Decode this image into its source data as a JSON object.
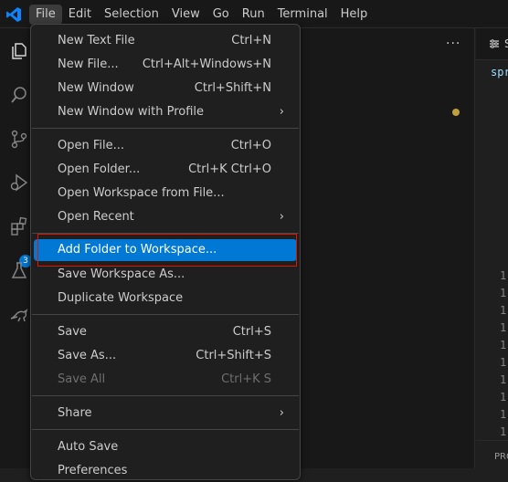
{
  "menubar": {
    "items": [
      "File",
      "Edit",
      "Selection",
      "View",
      "Go",
      "Run",
      "Terminal",
      "Help"
    ]
  },
  "activity": {
    "extensions_badge": "3"
  },
  "sidebar": {
    "more_actions": "···"
  },
  "editor": {
    "tab_label": "S",
    "code_text": "spr",
    "line_numbers": [
      "1",
      "1",
      "1",
      "1",
      "1",
      "1",
      "1",
      "1",
      "1",
      "1"
    ],
    "panel_tab": "PRO"
  },
  "file_menu": {
    "items": [
      {
        "label": "New Text File",
        "shortcut": "Ctrl+N"
      },
      {
        "label": "New File...",
        "shortcut": "Ctrl+Alt+Windows+N"
      },
      {
        "label": "New Window",
        "shortcut": "Ctrl+Shift+N"
      },
      {
        "label": "New Window with Profile",
        "shortcut": ""
      },
      {
        "label": "Open File...",
        "shortcut": "Ctrl+O"
      },
      {
        "label": "Open Folder...",
        "shortcut": "Ctrl+K Ctrl+O"
      },
      {
        "label": "Open Workspace from File...",
        "shortcut": ""
      },
      {
        "label": "Open Recent",
        "shortcut": ""
      },
      {
        "label": "Add Folder to Workspace...",
        "shortcut": ""
      },
      {
        "label": "Save Workspace As...",
        "shortcut": ""
      },
      {
        "label": "Duplicate Workspace",
        "shortcut": ""
      },
      {
        "label": "Save",
        "shortcut": "Ctrl+S"
      },
      {
        "label": "Save As...",
        "shortcut": "Ctrl+Shift+S"
      },
      {
        "label": "Save All",
        "shortcut": "Ctrl+K S"
      },
      {
        "label": "Share",
        "shortcut": ""
      },
      {
        "label": "Auto Save",
        "shortcut": ""
      },
      {
        "label": "Preferences",
        "shortcut": ""
      }
    ]
  },
  "colors": {
    "accent": "#0078d4",
    "menu_bg": "#1f1f1f",
    "highlight_outline": "#e51400"
  }
}
